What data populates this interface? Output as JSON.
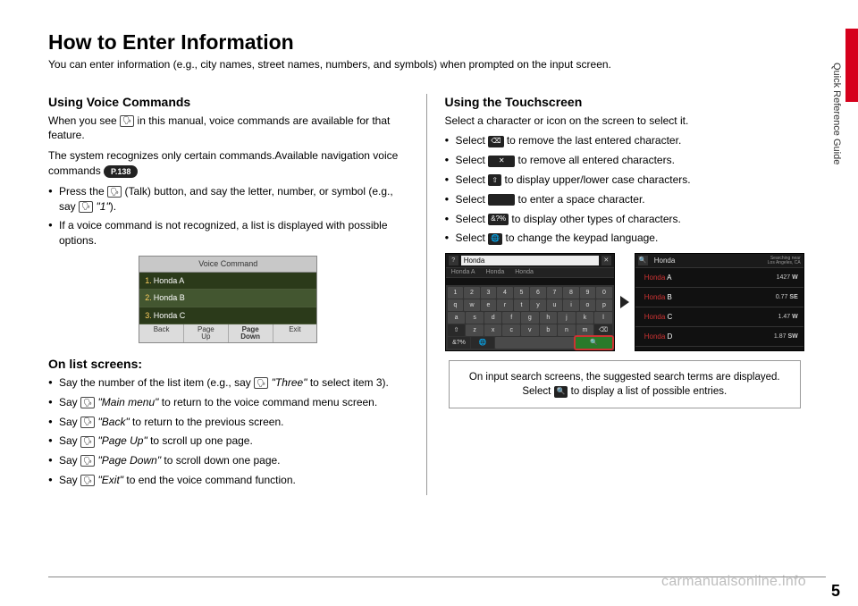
{
  "side_tab": "Quick Reference Guide",
  "page_number": "5",
  "watermark": "carmanualsonline.info",
  "title": "How to Enter Information",
  "intro": "You can enter information (e.g., city names, street names, numbers, and symbols) when prompted on the input screen.",
  "left": {
    "h_voice": "Using Voice Commands",
    "voice_p1a": "When you see ",
    "voice_p1b": " in this manual, voice commands are available for that feature.",
    "voice_p2": "The system recognizes only certain commands.Available navigation voice commands ",
    "pageref": "P.138",
    "bul1a": "Press the ",
    "bul1b": " (Talk) button, and say the letter, number, or symbol (e.g., say ",
    "bul1_quote": "\"1\"",
    "bul1c": ").",
    "bul2": "If a voice command is not recognized, a list is displayed with possible options.",
    "vc": {
      "title": "Voice Command",
      "rows": [
        "Honda A",
        "Honda B",
        "Honda C"
      ],
      "foot": [
        "Back",
        "Page\nUp",
        "Page\nDown",
        "Exit"
      ]
    },
    "h_list": "On list screens:",
    "l1a": "Say the number of the list item (e.g., say ",
    "l1_quote": "\"Three\"",
    "l1b": " to select item 3).",
    "l2a": "Say ",
    "l2_quote": "\"Main menu\"",
    "l2b": " to return to the voice command menu screen.",
    "l3a": "Say ",
    "l3_quote": "\"Back\"",
    "l3b": " to return to the previous screen.",
    "l4a": "Say ",
    "l4_quote": "\"Page Up\"",
    "l4b": " to scroll up one page.",
    "l5a": "Say ",
    "l5_quote": "\"Page Down\"",
    "l5b": " to scroll down one page.",
    "l6a": "Say ",
    "l6_quote": "\"Exit\"",
    "l6b": " to end the voice command function."
  },
  "right": {
    "h_touch": "Using the Touchscreen",
    "touch_p1": "Select a character or icon on the screen to select it.",
    "t1a": "Select ",
    "t1b": " to remove the last entered character.",
    "t2a": "Select ",
    "t2b": " to remove all entered characters.",
    "t3a": "Select ",
    "t3b": " to display upper/lower case characters.",
    "t4a": "Select ",
    "t4b": " to enter a space character.",
    "t5a": "Select ",
    "t5b": " to display other types of characters.",
    "t6a": "Select ",
    "t6b": " to change the keypad language.",
    "icons": {
      "backspace": "⌫",
      "clear": "✕",
      "shift": "⇧",
      "space": " ",
      "symbols": "&?%",
      "globe": "🌐",
      "talk": "🗣",
      "search": "🔍",
      "back": "?"
    },
    "kb_shot": {
      "back_icon": "?",
      "search_value": "Honda",
      "suggest": [
        "Honda A",
        "Honda",
        "Honda"
      ],
      "row1": [
        "1",
        "2",
        "3",
        "4",
        "5",
        "6",
        "7",
        "8",
        "9",
        "0"
      ],
      "row2": [
        "q",
        "w",
        "e",
        "r",
        "t",
        "y",
        "u",
        "i",
        "o",
        "p"
      ],
      "row3": [
        "a",
        "s",
        "d",
        "f",
        "g",
        "h",
        "j",
        "k",
        "l"
      ],
      "row4_shift": "⇧",
      "row4": [
        "z",
        "x",
        "c",
        "v",
        "b",
        "n",
        "m"
      ],
      "row4_bksp": "⌫",
      "row5_sym": "&?%",
      "row5_globe": "🌐",
      "row5_search": "🔍"
    },
    "list_shot": {
      "search_icon": "🔍",
      "search_value": "Honda",
      "location": "Searching near\nLos Angeles, CA",
      "rows": [
        {
          "brand": "Honda",
          "suffix": " A",
          "dist": "1427",
          "dir": "W"
        },
        {
          "brand": "Honda",
          "suffix": " B",
          "dist": "0.77",
          "dir": "SE"
        },
        {
          "brand": "Honda",
          "suffix": " C",
          "dist": "1.47",
          "dir": "W"
        },
        {
          "brand": "Honda",
          "suffix": " D",
          "dist": "1.87",
          "dir": "SW"
        }
      ]
    },
    "note_a": "On input search screens, the suggested search terms are displayed. Select ",
    "note_b": " to display a list of possible entries."
  }
}
